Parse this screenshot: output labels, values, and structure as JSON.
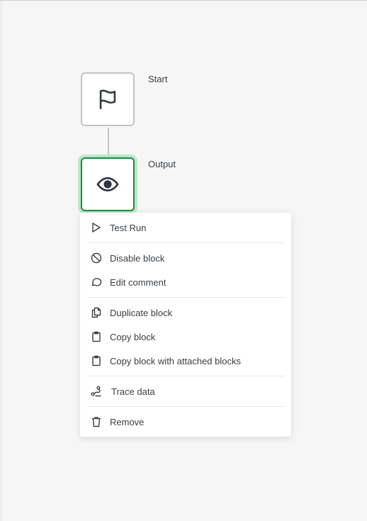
{
  "canvas": {
    "nodes": [
      {
        "label": "Start",
        "icon": "flag-icon",
        "selected": false
      },
      {
        "label": "Output",
        "icon": "eye-icon",
        "selected": true
      }
    ],
    "colors": {
      "selected_border": "#1a8c3f",
      "selected_glow": "#bfe5cb",
      "node_border": "#c4c4c4",
      "background": "#f6f6f6"
    }
  },
  "context_menu": {
    "items": [
      {
        "label": "Test Run",
        "icon": "play-icon"
      },
      {
        "label": "Disable block",
        "icon": "disable-icon"
      },
      {
        "label": "Edit comment",
        "icon": "comment-icon"
      },
      {
        "label": "Duplicate block",
        "icon": "duplicate-icon"
      },
      {
        "label": "Copy block",
        "icon": "clipboard-icon"
      },
      {
        "label": "Copy block with attached blocks",
        "icon": "clipboard-icon"
      },
      {
        "label": "Trace data",
        "icon": "trace-icon"
      },
      {
        "label": "Remove",
        "icon": "trash-icon"
      }
    ]
  }
}
